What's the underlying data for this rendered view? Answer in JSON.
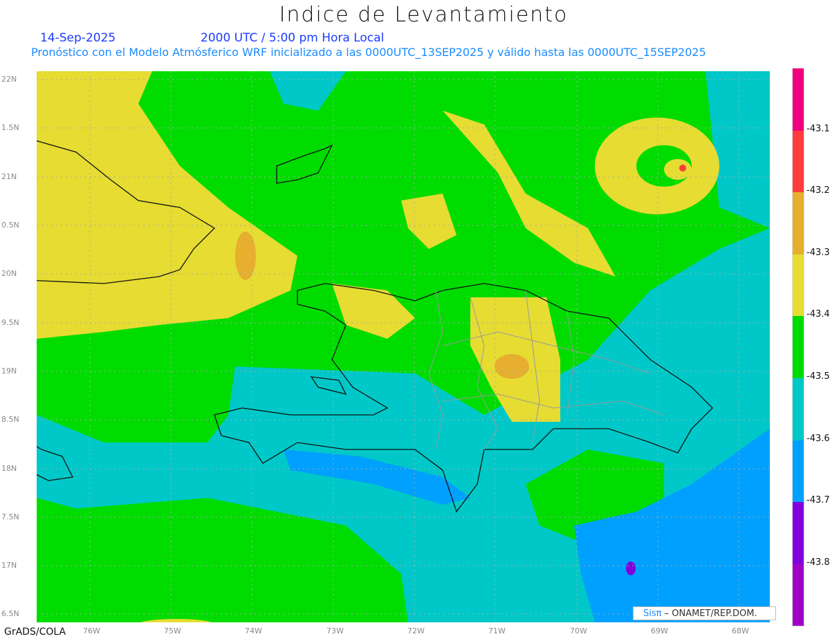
{
  "title": "Indice de Levantamiento",
  "date": "14-Sep-2025",
  "time": "2000 UTC / 5:00 pm Hora Local",
  "subtitle": "Pronóstico con el Modelo Atmósferico WRF inicializado a las 0000UTC_13SEP2025 y válido hasta las  0000UTC_15SEP2025",
  "y_labels": [
    "22N",
    "1.5N",
    "21N",
    "0.5N",
    "20N",
    "9.5N",
    "19N",
    "8.5N",
    "18N",
    "7.5N",
    "17N",
    "6.5N"
  ],
  "x_labels": [
    "76W",
    "75W",
    "74W",
    "73W",
    "72W",
    "71W",
    "70W",
    "69W",
    "68W"
  ],
  "colorbar": {
    "colors": [
      "#f0007f",
      "#ff3c3c",
      "#e6af2e",
      "#e6dc32",
      "#00dc00",
      "#00c8c8",
      "#00a0ff",
      "#8200dc",
      "#a000c8"
    ],
    "labels": [
      "-43.1",
      "-43.2",
      "-43.3",
      "-43.4",
      "-43.5",
      "-43.6",
      "-43.7",
      "-43.8"
    ]
  },
  "footer": {
    "grads": "GrADS/COLA",
    "logo_brand": "Sisπ",
    "logo_org": " – ONAMET/REP.DOM."
  }
}
